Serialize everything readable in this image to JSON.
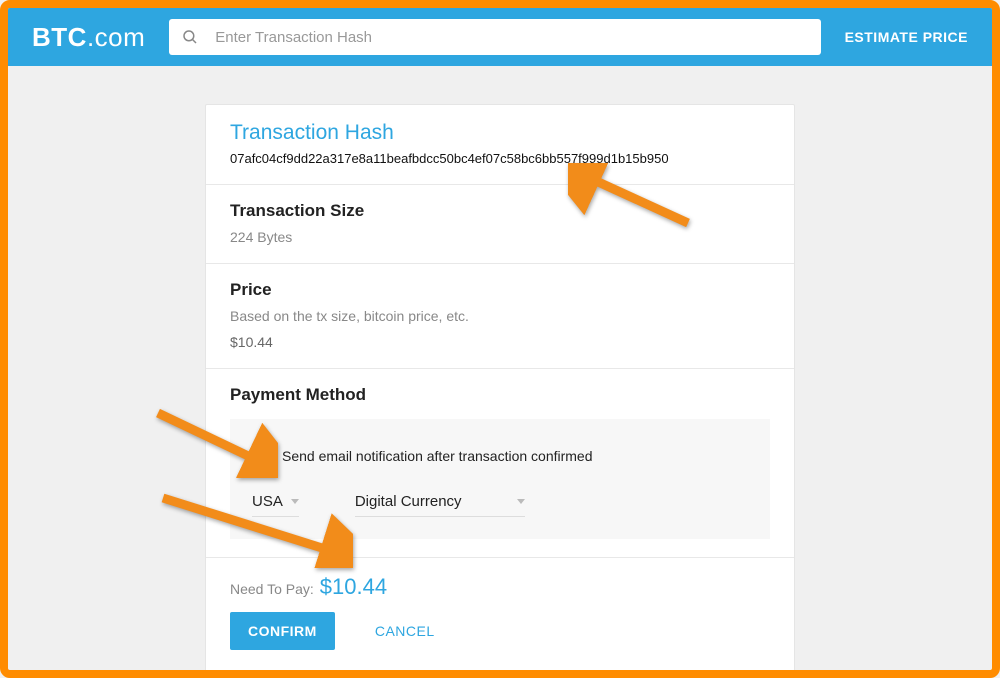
{
  "brand": {
    "main": "BTC",
    "suffix": ".com"
  },
  "search": {
    "placeholder": "Enter Transaction Hash"
  },
  "nav": {
    "estimate": "ESTIMATE PRICE"
  },
  "tx": {
    "hash_label": "Transaction Hash",
    "hash": "07afc04cf9dd22a317e8a11beafbdcc50bc4ef07c58bc6bb557f999d1b15b950",
    "size_label": "Transaction Size",
    "size_value": "224 Bytes",
    "price_label": "Price",
    "price_desc": "Based on the tx size, bitcoin price, etc.",
    "price_value": "$10.44",
    "payment_label": "Payment Method",
    "email_notify": "Send email notification after transaction confirmed",
    "country": "USA",
    "method": "Digital Currency",
    "need_label": "Need To Pay:",
    "need_amount": "$10.44",
    "confirm": "CONFIRM",
    "cancel": "CANCEL"
  },
  "colors": {
    "accent": "#2ea6e0",
    "frame": "#ff8c00"
  }
}
